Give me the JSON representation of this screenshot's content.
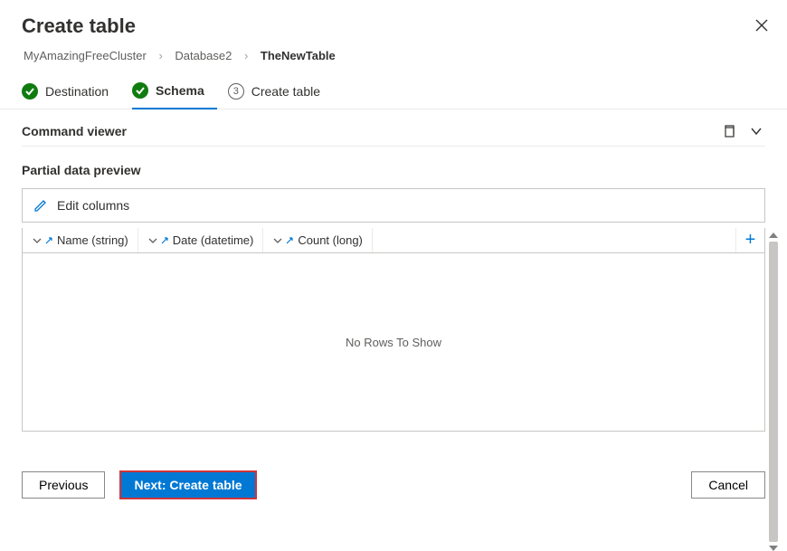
{
  "header": {
    "title": "Create table"
  },
  "breadcrumb": {
    "items": [
      "MyAmazingFreeCluster",
      "Database2",
      "TheNewTable"
    ]
  },
  "stepper": {
    "steps": [
      {
        "label": "Destination",
        "state": "done"
      },
      {
        "label": "Schema",
        "state": "active"
      },
      {
        "label": "Create table",
        "state": "pending",
        "num": "3"
      }
    ]
  },
  "command_viewer": {
    "label": "Command viewer"
  },
  "preview": {
    "label": "Partial data preview",
    "edit_columns": "Edit columns",
    "columns": [
      {
        "label": "Name (string)"
      },
      {
        "label": "Date (datetime)"
      },
      {
        "label": "Count (long)"
      }
    ],
    "empty_message": "No Rows To Show"
  },
  "footer": {
    "previous": "Previous",
    "next": "Next: Create table",
    "cancel": "Cancel"
  }
}
